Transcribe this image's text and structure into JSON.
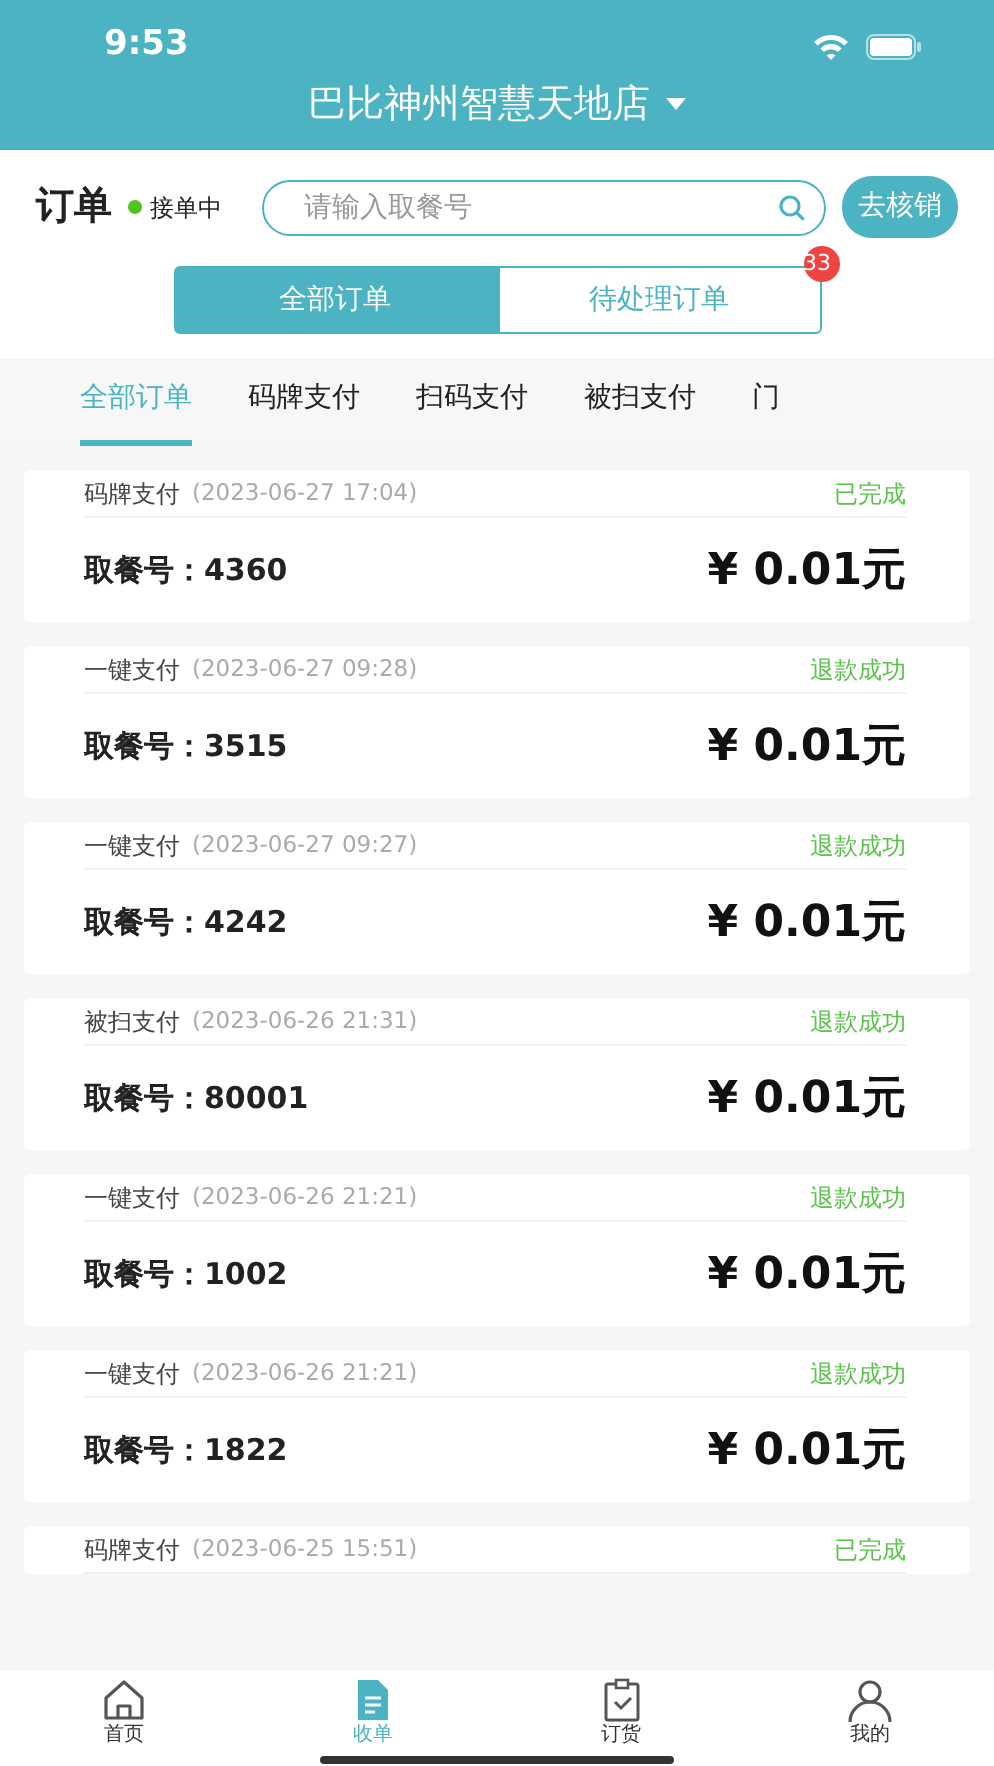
{
  "status_bar": {
    "time": "9:53"
  },
  "header": {
    "store": "巴比神州智慧天地店"
  },
  "toolbar": {
    "title": "订单",
    "status": "接单中",
    "status_on": true,
    "search": {
      "placeholder": "请输入取餐号"
    },
    "verify_button": "去核销"
  },
  "segments": [
    {
      "label": "全部订单",
      "selected": true
    },
    {
      "label": "待处理订单",
      "selected": false,
      "badge": "33"
    }
  ],
  "tabs": [
    {
      "label": "全部订单",
      "selected": true
    },
    {
      "label": "码牌支付",
      "selected": false
    },
    {
      "label": "扫码支付",
      "selected": false
    },
    {
      "label": "被扫支付",
      "selected": false
    },
    {
      "label": "门",
      "selected": false
    }
  ],
  "orders": [
    {
      "method": "码牌支付",
      "time": "(2023-06-27 17:04)",
      "status": "已完成",
      "pickup": "取餐号：4360",
      "amount": "¥ 0.01元"
    },
    {
      "method": "一键支付",
      "time": "(2023-06-27 09:28)",
      "status": "退款成功",
      "pickup": "取餐号：3515",
      "amount": "¥ 0.01元"
    },
    {
      "method": "一键支付",
      "time": "(2023-06-27 09:27)",
      "status": "退款成功",
      "pickup": "取餐号：4242",
      "amount": "¥ 0.01元"
    },
    {
      "method": "被扫支付",
      "time": "(2023-06-26 21:31)",
      "status": "退款成功",
      "pickup": "取餐号：80001",
      "amount": "¥ 0.01元"
    },
    {
      "method": "一键支付",
      "time": "(2023-06-26 21:21)",
      "status": "退款成功",
      "pickup": "取餐号：1002",
      "amount": "¥ 0.01元"
    },
    {
      "method": "一键支付",
      "time": "(2023-06-26 21:21)",
      "status": "退款成功",
      "pickup": "取餐号：1822",
      "amount": "¥ 0.01元"
    },
    {
      "method": "码牌支付",
      "time": "(2023-06-25 15:51)",
      "status": "已完成"
    }
  ],
  "bottom_nav": [
    {
      "label": "首页",
      "kind": "home",
      "selected": false
    },
    {
      "label": "收单",
      "kind": "doc",
      "selected": true
    },
    {
      "label": "订货",
      "kind": "clipboard",
      "selected": false
    },
    {
      "label": "我的",
      "kind": "person",
      "selected": false
    }
  ]
}
